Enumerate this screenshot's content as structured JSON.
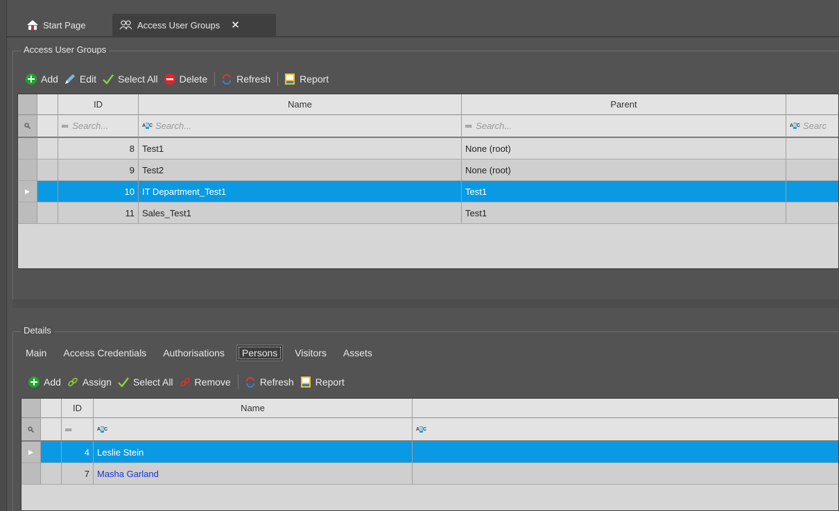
{
  "doc_tabs": {
    "start_page": "Start Page",
    "access_user_groups": "Access User Groups",
    "close_glyph": "✕"
  },
  "groups_panel": {
    "title": "Access User Groups",
    "toolbar": {
      "add": "Add",
      "edit": "Edit",
      "select_all": "Select All",
      "delete": "Delete",
      "refresh": "Refresh",
      "report": "Report"
    },
    "columns": {
      "id": "ID",
      "name": "Name",
      "parent": "Parent"
    },
    "filter_placeholder": "Search...",
    "filter_placeholder_cut": "Searc",
    "rows": [
      {
        "id": "8",
        "name": "Test1",
        "parent": "None (root)"
      },
      {
        "id": "9",
        "name": "Test2",
        "parent": "None (root)"
      },
      {
        "id": "10",
        "name": "IT Department_Test1",
        "parent": "Test1"
      },
      {
        "id": "11",
        "name": "Sales_Test1",
        "parent": "Test1"
      }
    ]
  },
  "details_panel": {
    "title": "Details",
    "tabs": [
      "Main",
      "Access Credentials",
      "Authorisations",
      "Persons",
      "Visitors",
      "Assets"
    ],
    "active_tab": "Persons",
    "toolbar": {
      "add": "Add",
      "assign": "Assign",
      "select_all": "Select All",
      "remove": "Remove",
      "refresh": "Refresh",
      "report": "Report"
    },
    "columns": {
      "id": "ID",
      "name": "Name"
    },
    "rows": [
      {
        "id": "4",
        "name": "Leslie Stein"
      },
      {
        "id": "7",
        "name": "Masha Garland"
      }
    ]
  },
  "colors": {
    "selection": "#0a9ae3",
    "link": "#1a35d6",
    "add_green": "#1fa62c",
    "delete_red": "#e0252b"
  }
}
